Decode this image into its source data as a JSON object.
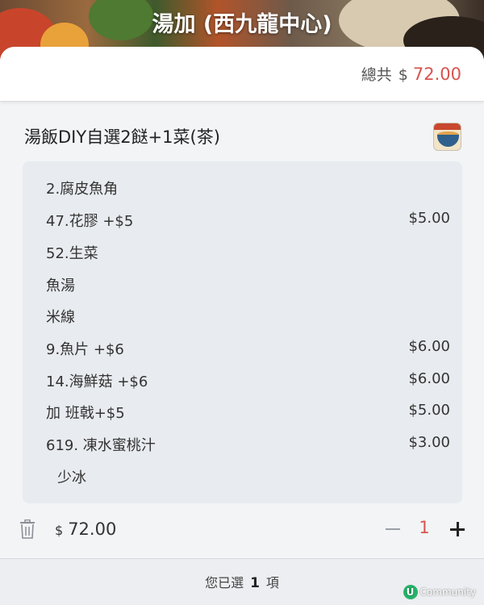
{
  "header": {
    "title": "湯加 (西九龍中心)"
  },
  "summary": {
    "total_label": "總共",
    "currency": "$",
    "total_value": "72.00",
    "accent_color": "#d9534f"
  },
  "item": {
    "title": "湯飯DIY自選2餸+1菜(茶)",
    "thumbnail_icon": "food-bowl-icon",
    "options": [
      {
        "name": "2.腐皮魚角",
        "price": ""
      },
      {
        "name": "47.花膠 +$5",
        "price": "$5.00"
      },
      {
        "name": "52.生菜",
        "price": ""
      },
      {
        "name": "魚湯",
        "price": ""
      },
      {
        "name": "米線",
        "price": ""
      },
      {
        "name": "9.魚片 +$6",
        "price": "$6.00"
      },
      {
        "name": "14.海鮮菇 +$6",
        "price": "$6.00"
      },
      {
        "name": "加 班戟+$5",
        "price": "$5.00"
      },
      {
        "name": "619. 凍水蜜桃汁",
        "price": "$3.00"
      },
      {
        "name": "少冰",
        "price": ""
      }
    ],
    "line_currency": "$",
    "line_total": "72.00",
    "quantity": "1",
    "delete_icon": "trash-icon",
    "minus_icon": "minus-icon",
    "plus_icon": "plus-icon"
  },
  "footer": {
    "prefix": "您已選",
    "count": "1",
    "suffix": "項"
  },
  "watermark": {
    "logo": "U",
    "text": "Community"
  }
}
